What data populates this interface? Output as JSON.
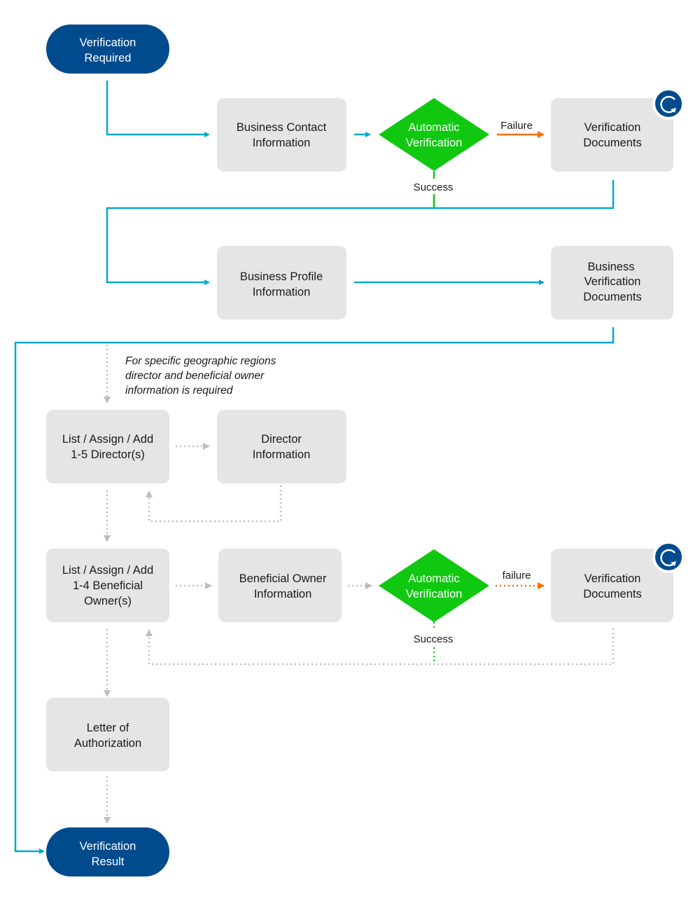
{
  "colors": {
    "pill": "#004b8d",
    "box": "#e5e5e5",
    "decision": "#0fc80f",
    "main_flow": "#00aacc",
    "failure": "#ff6a00",
    "optional_flow": "#bdbdbd"
  },
  "nodes": {
    "start": [
      "Verification",
      "Required"
    ],
    "business_contact": [
      "Business Contact",
      "Information"
    ],
    "auto_verify_1": [
      "Automatic",
      "Verification"
    ],
    "verification_docs_1": [
      "Verification",
      "Documents"
    ],
    "business_profile": [
      "Business Profile",
      "Information"
    ],
    "business_verification_docs": [
      "Business",
      "Verification",
      "Documents"
    ],
    "list_directors": [
      "List / Assign / Add",
      "1-5 Director(s)"
    ],
    "director_info": [
      "Director",
      "Information"
    ],
    "list_owners": [
      "List / Assign / Add",
      "1-4 Beneficial",
      "Owner(s)"
    ],
    "owner_info": [
      "Beneficial Owner",
      "Information"
    ],
    "auto_verify_2": [
      "Automatic",
      "Verification"
    ],
    "verification_docs_2": [
      "Verification",
      "Documents"
    ],
    "letter": [
      "Letter of",
      "Authorization"
    ],
    "result": [
      "Verification",
      "Result"
    ]
  },
  "labels": {
    "failure_1": "Failure",
    "success_1": "Success",
    "failure_2": "failure",
    "success_2": "Success"
  },
  "note": [
    "For specific geographic regions",
    "director and beneficial owner",
    "information is required"
  ],
  "icons": [
    "refresh-icon",
    "refresh-icon"
  ]
}
